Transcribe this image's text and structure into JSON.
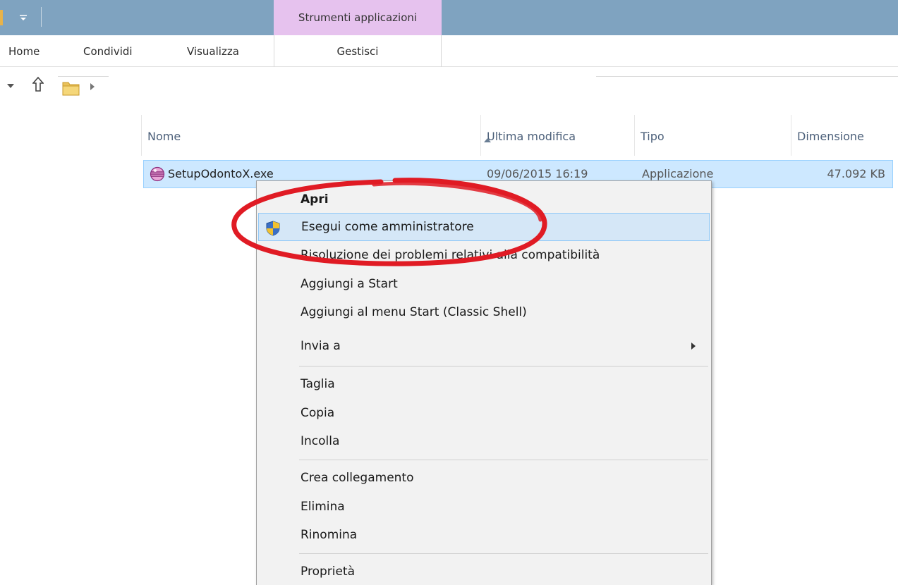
{
  "titlebar": {
    "context_tab_header": "Strumenti applicazioni"
  },
  "ribbon": {
    "tabs": [
      {
        "label": "Home"
      },
      {
        "label": "Condividi"
      },
      {
        "label": "Visualizza"
      },
      {
        "label": "Gestisci"
      }
    ]
  },
  "columns": {
    "name": "Nome",
    "modified": "Ultima modifica",
    "type": "Tipo",
    "size": "Dimensione"
  },
  "file": {
    "name": "SetupOdontoX.exe",
    "modified": "09/06/2015 16:19",
    "type": "Applicazione",
    "size": "47.092 KB"
  },
  "context_menu": {
    "items": [
      {
        "label": "Apri"
      },
      {
        "label": "Esegui come amministratore"
      },
      {
        "label": "Risoluzione dei problemi relativi alla compatibilità"
      },
      {
        "label": "Aggiungi a Start"
      },
      {
        "label": "Aggiungi al menu Start (Classic Shell)"
      },
      {
        "label": "Invia a"
      },
      {
        "label": "Taglia"
      },
      {
        "label": "Copia"
      },
      {
        "label": "Incolla"
      },
      {
        "label": "Crea collegamento"
      },
      {
        "label": "Elimina"
      },
      {
        "label": "Rinomina"
      },
      {
        "label": "Proprietà"
      }
    ]
  },
  "colors": {
    "titlebar": "#7fa3c0",
    "context_tab": "#e6c2ee",
    "selection": "#cde8ff",
    "menu_highlight": "#d5e7f7",
    "annotation": "#e01b24"
  }
}
